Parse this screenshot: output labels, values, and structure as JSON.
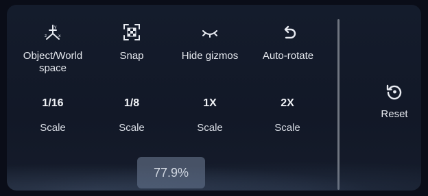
{
  "toolbar": {
    "tools": [
      {
        "label": "Object/World\nspace",
        "icon": "axis-gizmo-icon"
      },
      {
        "label": "Snap",
        "icon": "snap-grid-icon"
      },
      {
        "label": "Hide gizmos",
        "icon": "closed-eye-icon"
      },
      {
        "label": "Auto-rotate",
        "icon": "auto-rotate-icon"
      }
    ],
    "scales": [
      {
        "value": "1/16",
        "caption": "Scale"
      },
      {
        "value": "1/8",
        "caption": "Scale"
      },
      {
        "value": "1X",
        "caption": "Scale"
      },
      {
        "value": "2X",
        "caption": "Scale"
      }
    ],
    "reset": {
      "label": "Reset",
      "icon": "reset-icon"
    }
  },
  "zoom": {
    "value": "77.9%"
  },
  "colors": {
    "panel_background": "#141c2c",
    "text": "#e6e9ef",
    "divider": "#6f7580",
    "chip_background": "#475266"
  }
}
